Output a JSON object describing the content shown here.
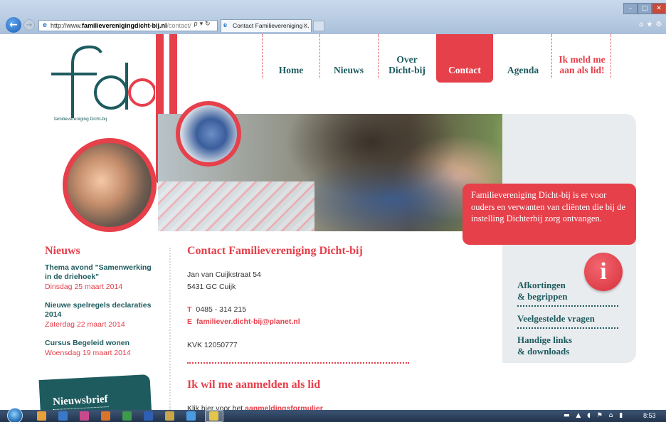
{
  "browser": {
    "address_prefix": "http://www.",
    "address_domain": "familieverenigingdicht-bij.nl",
    "address_path": "/contact/",
    "address_controls": "ρ ▾ ↻",
    "tab_title": "Contact Familievereniging ...",
    "tab_close": "✕",
    "back_icon": "←",
    "forward_icon": "→",
    "min_icon": "–",
    "max_icon": "□",
    "close_icon": "✕",
    "tool_icons": "⌂★⚙"
  },
  "logo": {
    "letters": "fdb",
    "tagline": "familievereniging Dicht-bij"
  },
  "nav": {
    "items": [
      {
        "label": "Home"
      },
      {
        "label": "Nieuws"
      },
      {
        "label": "Over\nDicht-bij"
      },
      {
        "label": "Contact"
      },
      {
        "label": "Agenda"
      },
      {
        "label": "Ik meld me\naan als lid!"
      }
    ]
  },
  "hero": {
    "callout": "Familievereniging Dicht-bij is er voor ouders en verwanten van cliënten die bij de instelling Dichterbij zorg ontvangen."
  },
  "news": {
    "title": "Nieuws",
    "items": [
      {
        "title": "Thema avond \"Samenwerking in de driehoek\"",
        "date": "Dinsdag 25 maart 2014"
      },
      {
        "title": "Nieuwe spelregels declaraties 2014",
        "date": "Zaterdag 22 maart 2014"
      },
      {
        "title": "Cursus Begeleid wonen",
        "date": "Woensdag 19 maart 2014"
      }
    ],
    "newsletter_label": "Nieuwsbrief"
  },
  "contact": {
    "heading": "Contact Familievereniging Dicht-bij",
    "street": "Jan van Cuijkstraat 54",
    "city": "5431 GC Cuijk",
    "phone_label": "T",
    "phone": "0485 - 314 215",
    "email_label": "E",
    "email": "familiever.dicht-bij@planet.nl",
    "kvk": "KVK 12050777"
  },
  "join": {
    "heading": "Ik wil me aanmelden als lid",
    "text_before": "Klik hier voor het ",
    "link": "aanmeldingsformulier",
    "text_after": "."
  },
  "info": {
    "icon_letter": "i",
    "links": [
      {
        "label": "Afkortingen\n& begrippen"
      },
      {
        "label": "Veelgestelde vragen"
      },
      {
        "label": "Handige links\n& downloads"
      }
    ]
  },
  "taskbar": {
    "tray": "▬ ▲ ◖ ⚑ ⌂ ▮",
    "clock": "8:53"
  },
  "colors": {
    "brand_red": "#e6404b",
    "brand_teal": "#1e5b5f"
  }
}
